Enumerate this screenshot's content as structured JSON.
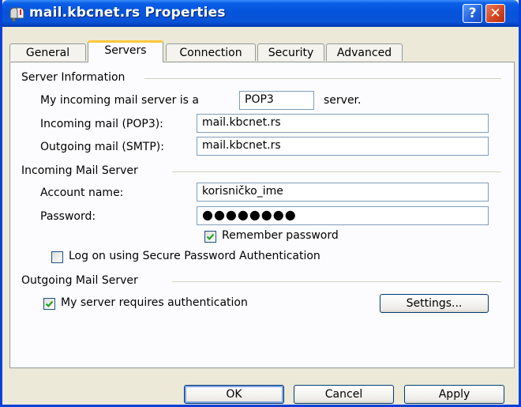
{
  "window": {
    "title": "mail.kbcnet.rs Properties",
    "help_label": "?",
    "close_label": "✕"
  },
  "tabs": [
    "General",
    "Servers",
    "Connection",
    "Security",
    "Advanced"
  ],
  "active_tab": "Servers",
  "server_info": {
    "heading": "Server Information",
    "incoming_prefix": "My incoming mail server is a",
    "server_type": "POP3",
    "incoming_suffix": "server.",
    "incoming_label": "Incoming mail (POP3):",
    "incoming_value": "mail.kbcnet.rs",
    "outgoing_label": "Outgoing mail (SMTP):",
    "outgoing_value": "mail.kbcnet.rs"
  },
  "incoming_server": {
    "heading": "Incoming Mail Server",
    "account_label": "Account name:",
    "account_value": "korisničko_ime",
    "password_label": "Password:",
    "password_value": "●●●●●●●●",
    "remember_label": "Remember password",
    "remember_checked": true,
    "spa_label": "Log on using Secure Password Authentication",
    "spa_checked": false
  },
  "outgoing_server": {
    "heading": "Outgoing Mail Server",
    "auth_label": "My server requires authentication",
    "auth_checked": true,
    "settings_label": "Settings..."
  },
  "buttons": {
    "ok": "OK",
    "cancel": "Cancel",
    "apply": "Apply"
  },
  "colors": {
    "titlebar": "#0453DB",
    "dialog_bg": "#ECE9D8",
    "check_green": "#21A121",
    "active_tab_accent": "#FFC83C"
  }
}
